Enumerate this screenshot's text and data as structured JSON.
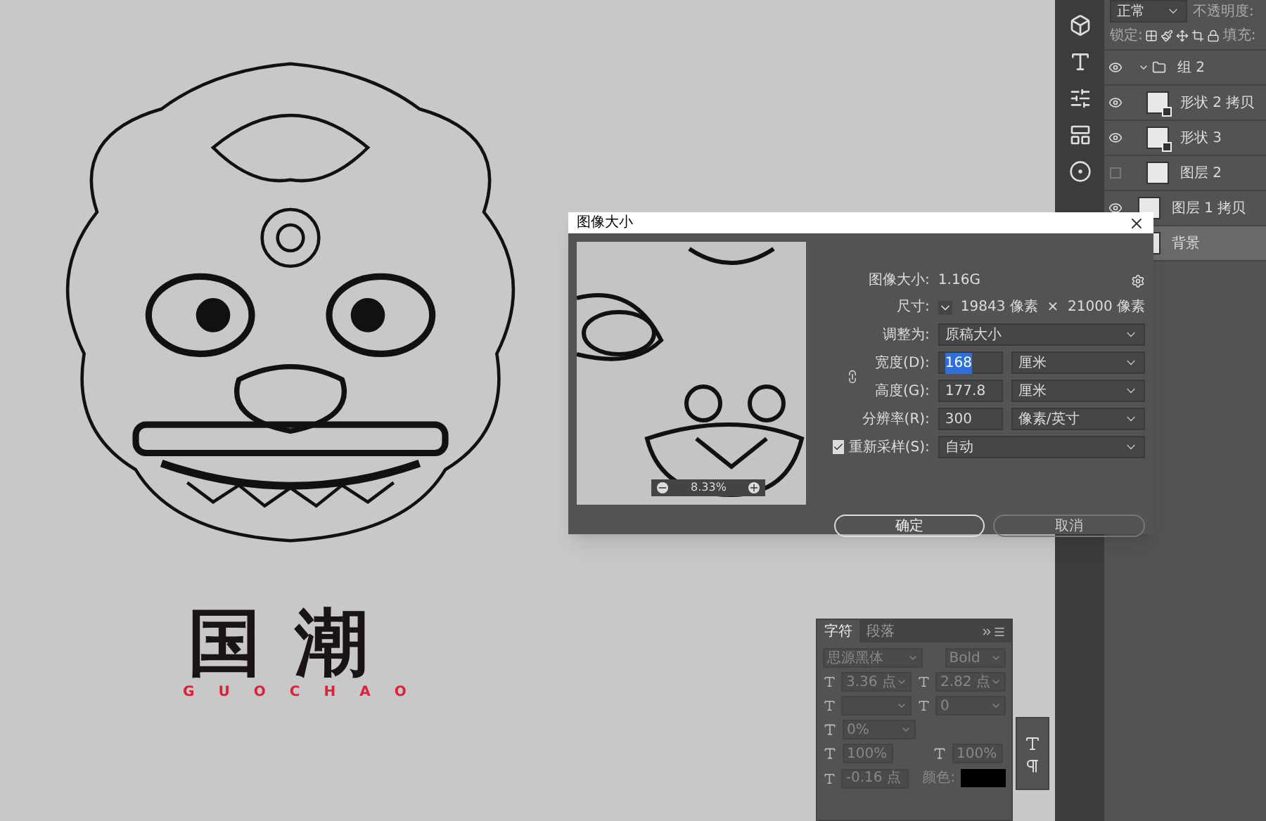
{
  "poster": {
    "title": "国潮",
    "subtitle": [
      "G",
      "U",
      "O",
      "C",
      "H",
      "A",
      "O"
    ]
  },
  "layers_panel": {
    "blend_mode": "正常",
    "opacity_label": "不透明度:",
    "lock_label": "锁定:",
    "fill_label": "填充:",
    "layers": [
      {
        "name": "组 2",
        "kind": "group",
        "visible": true,
        "selected": false,
        "expanded": true,
        "children": [
          {
            "name": "形状 2 拷贝",
            "kind": "shape",
            "visible": true,
            "selected": false
          },
          {
            "name": "形状 3",
            "kind": "shape",
            "visible": true,
            "selected": false
          },
          {
            "name": "图层 2",
            "kind": "layer",
            "visible": false,
            "selected": false
          }
        ]
      },
      {
        "name": "图层 1 拷贝",
        "kind": "layer",
        "visible": true,
        "selected": false
      },
      {
        "name": "背景",
        "kind": "layer",
        "selected": true
      }
    ]
  },
  "dialog": {
    "title": "图像大小",
    "zoom": "8.33%",
    "image_size_label": "图像大小:",
    "image_size": "1.16G",
    "dimensions_label": "尺寸:",
    "dimensions": "19843 像素  ×  21000 像素",
    "fit_label": "调整为:",
    "fit": "原稿大小",
    "fields": [
      {
        "label": "宽度(D):",
        "value": "168",
        "unit": "厘米",
        "selected": true
      },
      {
        "label": "高度(G):",
        "value": "177.8",
        "unit": "厘米",
        "selected": false
      },
      {
        "label": "分辨率(R):",
        "value": "300",
        "unit": "像素/英寸",
        "selected": false
      }
    ],
    "resample": {
      "label": "重新采样(S):",
      "checked": true,
      "value": "自动"
    },
    "buttons": [
      {
        "label": "确定",
        "primary": true
      },
      {
        "label": "取消",
        "primary": false
      }
    ]
  },
  "character_panel": {
    "tabs": [
      {
        "label": "字符",
        "selected": true
      },
      {
        "label": "段落",
        "selected": false
      }
    ],
    "font": "思源黑体",
    "style": "Bold",
    "size": "3.36 点",
    "leading": "2.82 点",
    "tracking": "0",
    "baseline_scale": "0%",
    "vertical_scale": "100%",
    "horizontal_scale": "100%",
    "baseline_shift": "-0.16 点",
    "color_label": "颜色:"
  }
}
